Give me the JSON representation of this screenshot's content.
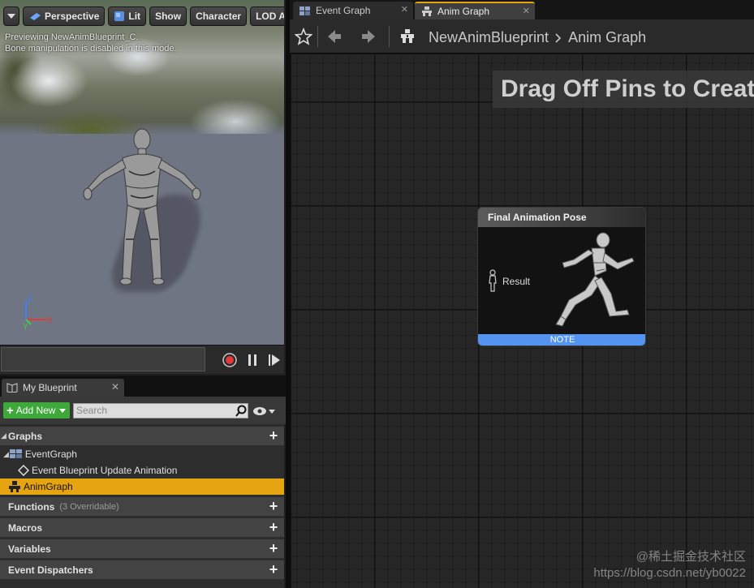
{
  "viewport": {
    "menu_arrow": "chevron-down-icon",
    "perspective_label": "Perspective",
    "lit_label": "Lit",
    "show_label": "Show",
    "character_label": "Character",
    "lod_label": "LOD Aut",
    "info_line1": "Previewing NewAnimBlueprint_C.",
    "info_line2": "Bone manipulation is disabled in this mode.",
    "axis_z": "Z",
    "axis_y": "Y",
    "axis_x": "X"
  },
  "my_blueprint": {
    "tab_label": "My Blueprint",
    "add_new_label": "Add New",
    "search_placeholder": "Search",
    "categories": {
      "graphs": "Graphs",
      "functions": "Functions",
      "functions_sub": "(3 Overridable)",
      "macros": "Macros",
      "variables": "Variables",
      "event_dispatchers": "Event Dispatchers"
    },
    "tree": {
      "event_graph": "EventGraph",
      "event_update": "Event Blueprint Update Animation",
      "anim_graph": "AnimGraph"
    }
  },
  "editor": {
    "tabs": [
      "Event Graph",
      "Anim Graph"
    ],
    "active_tab": "Anim Graph",
    "breadcrumb_root": "NewAnimBlueprint",
    "breadcrumb_current": "Anim Graph",
    "hint_text": "Drag Off Pins to Create/C",
    "node": {
      "title": "Final Animation Pose",
      "pin_label": "Result",
      "note_label": "NOTE"
    }
  },
  "watermark": {
    "line1": "@稀土掘金技术社区",
    "line2": "https://blog.csdn.net/yb0022"
  },
  "colors": {
    "selection": "#e6a312",
    "add_new": "#3ea83a",
    "note_bar": "#5294f0"
  }
}
